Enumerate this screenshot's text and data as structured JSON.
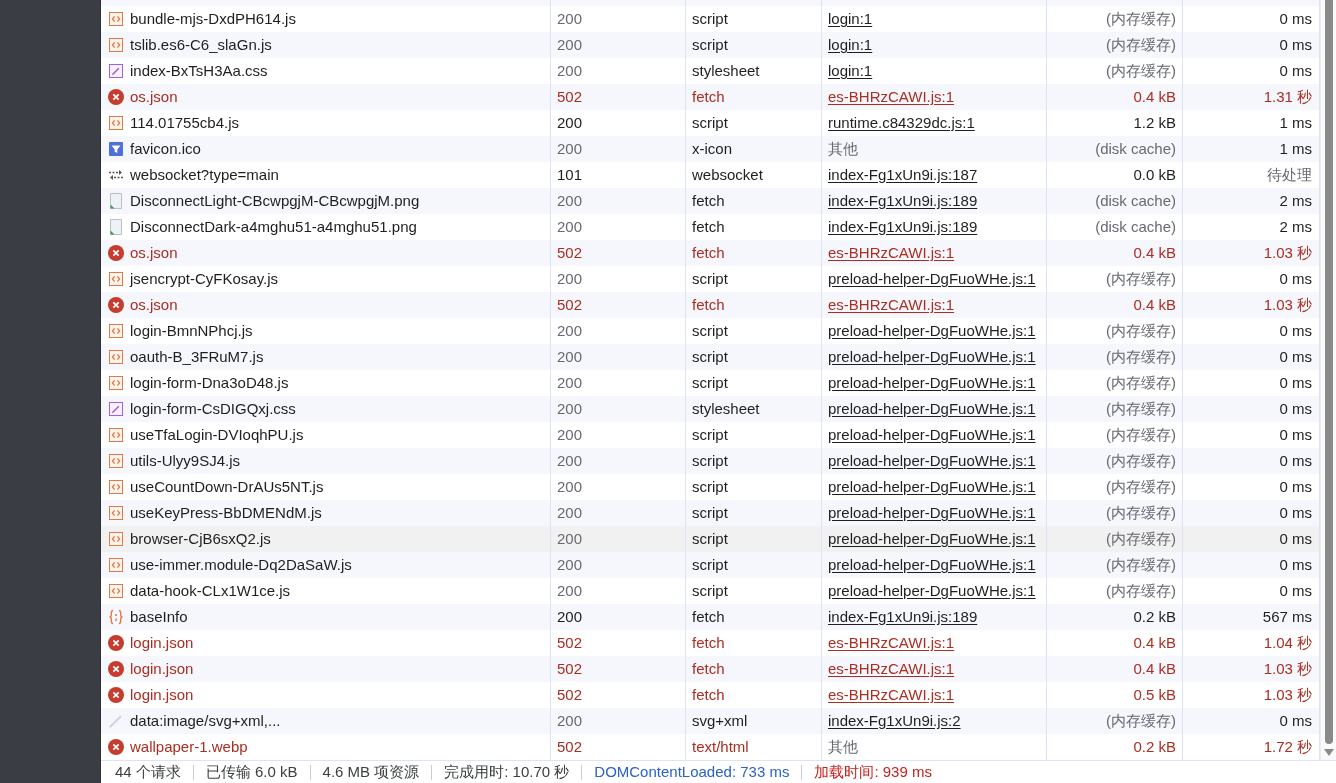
{
  "table": {
    "rows": [
      {
        "kind": "script",
        "name": "bundle-mjs-DxdPH614.js",
        "status": "200",
        "type": "script",
        "initiator": "login:1",
        "initiator_link": true,
        "size": "(内存缓存)",
        "time": "0 ms",
        "cached": true,
        "pending": false,
        "hovered": false
      },
      {
        "kind": "script",
        "name": "tslib.es6-C6_slaGn.js",
        "status": "200",
        "type": "script",
        "initiator": "login:1",
        "initiator_link": true,
        "size": "(内存缓存)",
        "time": "0 ms",
        "cached": true,
        "pending": false,
        "hovered": false
      },
      {
        "kind": "stylesheet",
        "name": "index-BxTsH3Aa.css",
        "status": "200",
        "type": "stylesheet",
        "initiator": "login:1",
        "initiator_link": true,
        "size": "(内存缓存)",
        "time": "0 ms",
        "cached": true,
        "pending": false,
        "hovered": false
      },
      {
        "kind": "error",
        "name": "os.json",
        "status": "502",
        "type": "fetch",
        "initiator": "es-BHRzCAWI.js:1",
        "initiator_link": true,
        "size": "0.4 kB",
        "time": "1.31 秒",
        "cached": false,
        "pending": false,
        "hovered": false
      },
      {
        "kind": "script",
        "name": "114.01755cb4.js",
        "status": "200",
        "type": "script",
        "initiator": "runtime.c84329dc.js:1",
        "initiator_link": true,
        "size": "1.2 kB",
        "time": "1 ms",
        "cached": false,
        "pending": false,
        "hovered": false
      },
      {
        "kind": "favicon",
        "name": "favicon.ico",
        "status": "200",
        "type": "x-icon",
        "initiator": "其他",
        "initiator_link": false,
        "size": "(disk cache)",
        "time": "1 ms",
        "cached": true,
        "pending": false,
        "hovered": false
      },
      {
        "kind": "websocket",
        "name": "websocket?type=main",
        "status": "101",
        "type": "websocket",
        "initiator": "index-Fg1xUn9i.js:187",
        "initiator_link": true,
        "size": "0.0 kB",
        "time": "待处理",
        "cached": false,
        "pending": true,
        "hovered": false
      },
      {
        "kind": "image",
        "name": "DisconnectLight-CBcwpgjM-CBcwpgjM.png",
        "status": "200",
        "type": "fetch",
        "initiator": "index-Fg1xUn9i.js:189",
        "initiator_link": true,
        "size": "(disk cache)",
        "time": "2 ms",
        "cached": true,
        "pending": false,
        "hovered": false
      },
      {
        "kind": "image",
        "name": "DisconnectDark-a4mghu51-a4mghu51.png",
        "status": "200",
        "type": "fetch",
        "initiator": "index-Fg1xUn9i.js:189",
        "initiator_link": true,
        "size": "(disk cache)",
        "time": "2 ms",
        "cached": true,
        "pending": false,
        "hovered": false
      },
      {
        "kind": "error",
        "name": "os.json",
        "status": "502",
        "type": "fetch",
        "initiator": "es-BHRzCAWI.js:1",
        "initiator_link": true,
        "size": "0.4 kB",
        "time": "1.03 秒",
        "cached": false,
        "pending": false,
        "hovered": false
      },
      {
        "kind": "script",
        "name": "jsencrypt-CyFKosay.js",
        "status": "200",
        "type": "script",
        "initiator": "preload-helper-DgFuoWHe.js:1",
        "initiator_link": true,
        "size": "(内存缓存)",
        "time": "0 ms",
        "cached": true,
        "pending": false,
        "hovered": false
      },
      {
        "kind": "error",
        "name": "os.json",
        "status": "502",
        "type": "fetch",
        "initiator": "es-BHRzCAWI.js:1",
        "initiator_link": true,
        "size": "0.4 kB",
        "time": "1.03 秒",
        "cached": false,
        "pending": false,
        "hovered": false
      },
      {
        "kind": "script",
        "name": "login-BmnNPhcj.js",
        "status": "200",
        "type": "script",
        "initiator": "preload-helper-DgFuoWHe.js:1",
        "initiator_link": true,
        "size": "(内存缓存)",
        "time": "0 ms",
        "cached": true,
        "pending": false,
        "hovered": false
      },
      {
        "kind": "script",
        "name": "oauth-B_3FRuM7.js",
        "status": "200",
        "type": "script",
        "initiator": "preload-helper-DgFuoWHe.js:1",
        "initiator_link": true,
        "size": "(内存缓存)",
        "time": "0 ms",
        "cached": true,
        "pending": false,
        "hovered": false
      },
      {
        "kind": "script",
        "name": "login-form-Dna3oD48.js",
        "status": "200",
        "type": "script",
        "initiator": "preload-helper-DgFuoWHe.js:1",
        "initiator_link": true,
        "size": "(内存缓存)",
        "time": "0 ms",
        "cached": true,
        "pending": false,
        "hovered": false
      },
      {
        "kind": "stylesheet",
        "name": "login-form-CsDIGQxj.css",
        "status": "200",
        "type": "stylesheet",
        "initiator": "preload-helper-DgFuoWHe.js:1",
        "initiator_link": true,
        "size": "(内存缓存)",
        "time": "0 ms",
        "cached": true,
        "pending": false,
        "hovered": false
      },
      {
        "kind": "script",
        "name": "useTfaLogin-DVIoqhPU.js",
        "status": "200",
        "type": "script",
        "initiator": "preload-helper-DgFuoWHe.js:1",
        "initiator_link": true,
        "size": "(内存缓存)",
        "time": "0 ms",
        "cached": true,
        "pending": false,
        "hovered": false
      },
      {
        "kind": "script",
        "name": "utils-Ulyy9SJ4.js",
        "status": "200",
        "type": "script",
        "initiator": "preload-helper-DgFuoWHe.js:1",
        "initiator_link": true,
        "size": "(内存缓存)",
        "time": "0 ms",
        "cached": true,
        "pending": false,
        "hovered": false
      },
      {
        "kind": "script",
        "name": "useCountDown-DrAUs5NT.js",
        "status": "200",
        "type": "script",
        "initiator": "preload-helper-DgFuoWHe.js:1",
        "initiator_link": true,
        "size": "(内存缓存)",
        "time": "0 ms",
        "cached": true,
        "pending": false,
        "hovered": false
      },
      {
        "kind": "script",
        "name": "useKeyPress-BbDMENdM.js",
        "status": "200",
        "type": "script",
        "initiator": "preload-helper-DgFuoWHe.js:1",
        "initiator_link": true,
        "size": "(内存缓存)",
        "time": "0 ms",
        "cached": true,
        "pending": false,
        "hovered": false
      },
      {
        "kind": "script",
        "name": "browser-CjB6sxQ2.js",
        "status": "200",
        "type": "script",
        "initiator": "preload-helper-DgFuoWHe.js:1",
        "initiator_link": true,
        "size": "(内存缓存)",
        "time": "0 ms",
        "cached": true,
        "pending": false,
        "hovered": true
      },
      {
        "kind": "script",
        "name": "use-immer.module-Dq2DaSaW.js",
        "status": "200",
        "type": "script",
        "initiator": "preload-helper-DgFuoWHe.js:1",
        "initiator_link": true,
        "size": "(内存缓存)",
        "time": "0 ms",
        "cached": true,
        "pending": false,
        "hovered": false
      },
      {
        "kind": "script",
        "name": "data-hook-CLx1W1ce.js",
        "status": "200",
        "type": "script",
        "initiator": "preload-helper-DgFuoWHe.js:1",
        "initiator_link": true,
        "size": "(内存缓存)",
        "time": "0 ms",
        "cached": true,
        "pending": false,
        "hovered": false
      },
      {
        "kind": "fetch",
        "name": "baseInfo",
        "status": "200",
        "type": "fetch",
        "initiator": "index-Fg1xUn9i.js:189",
        "initiator_link": true,
        "size": "0.2 kB",
        "time": "567 ms",
        "cached": false,
        "pending": false,
        "hovered": false
      },
      {
        "kind": "error",
        "name": "login.json",
        "status": "502",
        "type": "fetch",
        "initiator": "es-BHRzCAWI.js:1",
        "initiator_link": true,
        "size": "0.4 kB",
        "time": "1.04 秒",
        "cached": false,
        "pending": false,
        "hovered": false
      },
      {
        "kind": "error",
        "name": "login.json",
        "status": "502",
        "type": "fetch",
        "initiator": "es-BHRzCAWI.js:1",
        "initiator_link": true,
        "size": "0.4 kB",
        "time": "1.03 秒",
        "cached": false,
        "pending": false,
        "hovered": false
      },
      {
        "kind": "error",
        "name": "login.json",
        "status": "502",
        "type": "fetch",
        "initiator": "es-BHRzCAWI.js:1",
        "initiator_link": true,
        "size": "0.5 kB",
        "time": "1.03 秒",
        "cached": false,
        "pending": false,
        "hovered": false
      },
      {
        "kind": "svg",
        "name": "data:image/svg+xml,...",
        "status": "200",
        "type": "svg+xml",
        "initiator": "index-Fg1xUn9i.js:2",
        "initiator_link": true,
        "size": "(内存缓存)",
        "time": "0 ms",
        "cached": true,
        "pending": false,
        "hovered": false
      },
      {
        "kind": "error",
        "name": "wallpaper-1.webp",
        "status": "502",
        "type": "text/html",
        "initiator": "其他",
        "initiator_link": false,
        "size": "0.2 kB",
        "time": "1.72 秒",
        "cached": false,
        "pending": false,
        "hovered": false
      }
    ]
  },
  "status_bar": [
    {
      "kind": "plain",
      "text": "44 个请求"
    },
    {
      "kind": "plain",
      "text": "已传输 6.0 kB"
    },
    {
      "kind": "plain",
      "text": "4.6 MB 项资源"
    },
    {
      "kind": "plain",
      "text": "完成用时: 10.70 秒"
    },
    {
      "kind": "dom",
      "text": "DOMContentLoaded: 733 ms"
    },
    {
      "kind": "load",
      "text": "加载时间: 939 ms"
    }
  ]
}
